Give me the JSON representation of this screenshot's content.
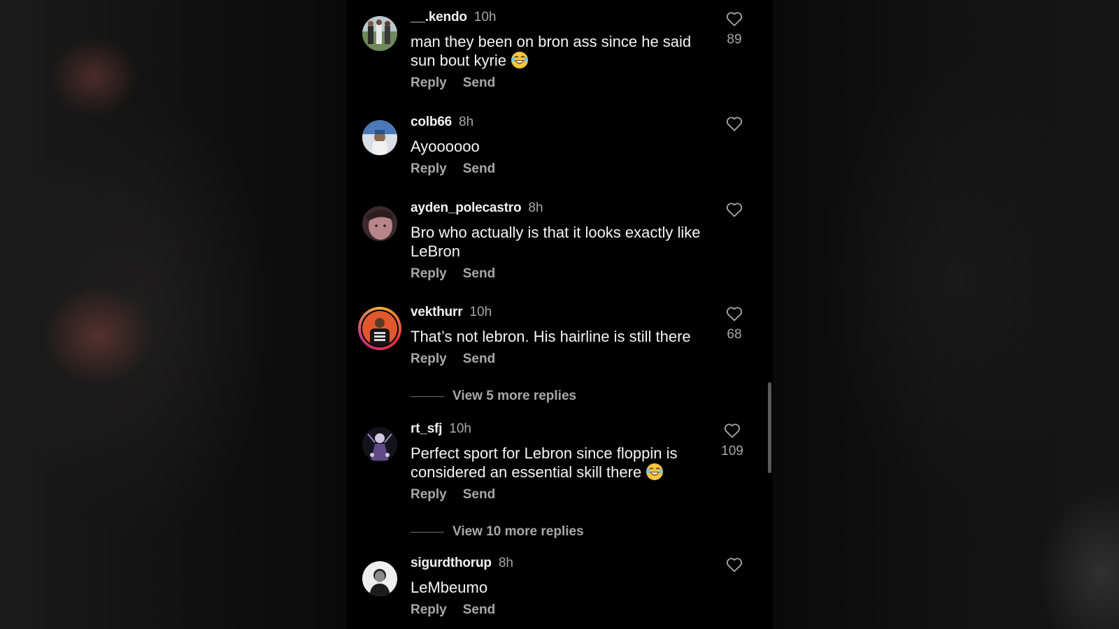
{
  "comments": [
    {
      "username": "__.kendo",
      "time": "10h",
      "text": "man they been on bron ass since he said sun bout kyrie",
      "emoji": "laughing-emoji",
      "likes": "89",
      "reply_label": "Reply",
      "send_label": "Send"
    },
    {
      "username": "colb66",
      "time": "8h",
      "text": "Ayoooooo",
      "likes": "",
      "reply_label": "Reply",
      "send_label": "Send"
    },
    {
      "username": "ayden_polecastro",
      "time": "8h",
      "text": "Bro who actually is that it looks exactly like LeBron",
      "likes": "",
      "reply_label": "Reply",
      "send_label": "Send"
    },
    {
      "username": "vekthurr",
      "time": "10h",
      "text": "That’s not lebron. His hairline is still there",
      "likes": "68",
      "reply_label": "Reply",
      "send_label": "Send",
      "view_replies": "View 5 more replies"
    },
    {
      "username": "rt_sfj",
      "time": "10h",
      "text": "Perfect sport for Lebron since floppin is considered an essential skill there",
      "emoji": "laughing-emoji",
      "likes": "109",
      "reply_label": "Reply",
      "send_label": "Send",
      "view_replies": "View 10 more replies"
    },
    {
      "username": "sigurdthorup",
      "time": "8h",
      "text": "LeMbeumo",
      "likes": "",
      "reply_label": "Reply",
      "send_label": "Send"
    }
  ],
  "colors": {
    "background": "#000000",
    "text_primary": "#f5f5f5",
    "text_secondary": "#a8a8a8",
    "story_ring": [
      "#f9b233",
      "#e7313e",
      "#c13584"
    ]
  }
}
